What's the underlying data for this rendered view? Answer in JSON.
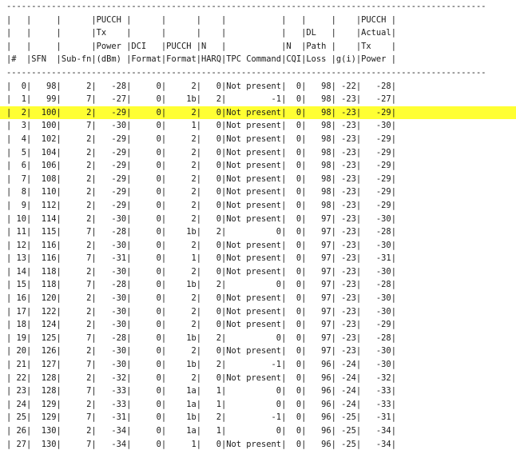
{
  "separator_top": "------------------------------------------------------------------------------------------------",
  "separator_mid": "------------------------------------------------------------------------------------------------",
  "header_lines": [
    "|   |     |      |PUCCH |      |      |    |           |   |     |    |PUCCH |",
    "|   |     |      |Tx    |      |      |    |           |   |DL   |    |Actual|",
    "|   |     |      |Power |DCI   |PUCCH |N   |           |N  |Path |    |Tx    |",
    "|#  |SFN  |Sub-fn|(dBm) |Format|Format|HARQ|TPC Command|CQI|Loss |g(i)|Power |"
  ],
  "columns": [
    "#",
    "SFN",
    "Sub-fn",
    "PUCCH Tx Power (dBm)",
    "DCI Format",
    "PUCCH Format",
    "N HARQ",
    "TPC Command",
    "N CQI",
    "DL Path Loss",
    "g(i)",
    "PUCCH Actual Tx Power"
  ],
  "highlight_color": "#ffff33",
  "highlighted_row_index": 2,
  "rows": [
    {
      "n": "0",
      "sfn": "98",
      "subfn": "2",
      "txpow": "-28",
      "dci": "0",
      "pucch": "2",
      "harq": "0",
      "tpc": "Not present",
      "cqi": "0",
      "pl": "98",
      "g": "-22",
      "actual": "-28"
    },
    {
      "n": "1",
      "sfn": "99",
      "subfn": "7",
      "txpow": "-27",
      "dci": "0",
      "pucch": "1b",
      "harq": "2",
      "tpc": "-1",
      "cqi": "0",
      "pl": "98",
      "g": "-23",
      "actual": "-27"
    },
    {
      "n": "2",
      "sfn": "100",
      "subfn": "2",
      "txpow": "-29",
      "dci": "0",
      "pucch": "2",
      "harq": "0",
      "tpc": "Not present",
      "cqi": "0",
      "pl": "98",
      "g": "-23",
      "actual": "-29"
    },
    {
      "n": "3",
      "sfn": "100",
      "subfn": "7",
      "txpow": "-30",
      "dci": "0",
      "pucch": "1",
      "harq": "0",
      "tpc": "Not present",
      "cqi": "0",
      "pl": "98",
      "g": "-23",
      "actual": "-30"
    },
    {
      "n": "4",
      "sfn": "102",
      "subfn": "2",
      "txpow": "-29",
      "dci": "0",
      "pucch": "2",
      "harq": "0",
      "tpc": "Not present",
      "cqi": "0",
      "pl": "98",
      "g": "-23",
      "actual": "-29"
    },
    {
      "n": "5",
      "sfn": "104",
      "subfn": "2",
      "txpow": "-29",
      "dci": "0",
      "pucch": "2",
      "harq": "0",
      "tpc": "Not present",
      "cqi": "0",
      "pl": "98",
      "g": "-23",
      "actual": "-29"
    },
    {
      "n": "6",
      "sfn": "106",
      "subfn": "2",
      "txpow": "-29",
      "dci": "0",
      "pucch": "2",
      "harq": "0",
      "tpc": "Not present",
      "cqi": "0",
      "pl": "98",
      "g": "-23",
      "actual": "-29"
    },
    {
      "n": "7",
      "sfn": "108",
      "subfn": "2",
      "txpow": "-29",
      "dci": "0",
      "pucch": "2",
      "harq": "0",
      "tpc": "Not present",
      "cqi": "0",
      "pl": "98",
      "g": "-23",
      "actual": "-29"
    },
    {
      "n": "8",
      "sfn": "110",
      "subfn": "2",
      "txpow": "-29",
      "dci": "0",
      "pucch": "2",
      "harq": "0",
      "tpc": "Not present",
      "cqi": "0",
      "pl": "98",
      "g": "-23",
      "actual": "-29"
    },
    {
      "n": "9",
      "sfn": "112",
      "subfn": "2",
      "txpow": "-29",
      "dci": "0",
      "pucch": "2",
      "harq": "0",
      "tpc": "Not present",
      "cqi": "0",
      "pl": "98",
      "g": "-23",
      "actual": "-29"
    },
    {
      "n": "10",
      "sfn": "114",
      "subfn": "2",
      "txpow": "-30",
      "dci": "0",
      "pucch": "2",
      "harq": "0",
      "tpc": "Not present",
      "cqi": "0",
      "pl": "97",
      "g": "-23",
      "actual": "-30"
    },
    {
      "n": "11",
      "sfn": "115",
      "subfn": "7",
      "txpow": "-28",
      "dci": "0",
      "pucch": "1b",
      "harq": "2",
      "tpc": "0",
      "cqi": "0",
      "pl": "97",
      "g": "-23",
      "actual": "-28"
    },
    {
      "n": "12",
      "sfn": "116",
      "subfn": "2",
      "txpow": "-30",
      "dci": "0",
      "pucch": "2",
      "harq": "0",
      "tpc": "Not present",
      "cqi": "0",
      "pl": "97",
      "g": "-23",
      "actual": "-30"
    },
    {
      "n": "13",
      "sfn": "116",
      "subfn": "7",
      "txpow": "-31",
      "dci": "0",
      "pucch": "1",
      "harq": "0",
      "tpc": "Not present",
      "cqi": "0",
      "pl": "97",
      "g": "-23",
      "actual": "-31"
    },
    {
      "n": "14",
      "sfn": "118",
      "subfn": "2",
      "txpow": "-30",
      "dci": "0",
      "pucch": "2",
      "harq": "0",
      "tpc": "Not present",
      "cqi": "0",
      "pl": "97",
      "g": "-23",
      "actual": "-30"
    },
    {
      "n": "15",
      "sfn": "118",
      "subfn": "7",
      "txpow": "-28",
      "dci": "0",
      "pucch": "1b",
      "harq": "2",
      "tpc": "0",
      "cqi": "0",
      "pl": "97",
      "g": "-23",
      "actual": "-28"
    },
    {
      "n": "16",
      "sfn": "120",
      "subfn": "2",
      "txpow": "-30",
      "dci": "0",
      "pucch": "2",
      "harq": "0",
      "tpc": "Not present",
      "cqi": "0",
      "pl": "97",
      "g": "-23",
      "actual": "-30"
    },
    {
      "n": "17",
      "sfn": "122",
      "subfn": "2",
      "txpow": "-30",
      "dci": "0",
      "pucch": "2",
      "harq": "0",
      "tpc": "Not present",
      "cqi": "0",
      "pl": "97",
      "g": "-23",
      "actual": "-30"
    },
    {
      "n": "18",
      "sfn": "124",
      "subfn": "2",
      "txpow": "-30",
      "dci": "0",
      "pucch": "2",
      "harq": "0",
      "tpc": "Not present",
      "cqi": "0",
      "pl": "97",
      "g": "-23",
      "actual": "-29"
    },
    {
      "n": "19",
      "sfn": "125",
      "subfn": "7",
      "txpow": "-28",
      "dci": "0",
      "pucch": "1b",
      "harq": "2",
      "tpc": "0",
      "cqi": "0",
      "pl": "97",
      "g": "-23",
      "actual": "-28"
    },
    {
      "n": "20",
      "sfn": "126",
      "subfn": "2",
      "txpow": "-30",
      "dci": "0",
      "pucch": "2",
      "harq": "0",
      "tpc": "Not present",
      "cqi": "0",
      "pl": "97",
      "g": "-23",
      "actual": "-30"
    },
    {
      "n": "21",
      "sfn": "127",
      "subfn": "7",
      "txpow": "-30",
      "dci": "0",
      "pucch": "1b",
      "harq": "2",
      "tpc": "-1",
      "cqi": "0",
      "pl": "96",
      "g": "-24",
      "actual": "-30"
    },
    {
      "n": "22",
      "sfn": "128",
      "subfn": "2",
      "txpow": "-32",
      "dci": "0",
      "pucch": "2",
      "harq": "0",
      "tpc": "Not present",
      "cqi": "0",
      "pl": "96",
      "g": "-24",
      "actual": "-32"
    },
    {
      "n": "23",
      "sfn": "128",
      "subfn": "7",
      "txpow": "-33",
      "dci": "0",
      "pucch": "1a",
      "harq": "1",
      "tpc": "0",
      "cqi": "0",
      "pl": "96",
      "g": "-24",
      "actual": "-33"
    },
    {
      "n": "24",
      "sfn": "129",
      "subfn": "2",
      "txpow": "-33",
      "dci": "0",
      "pucch": "1a",
      "harq": "1",
      "tpc": "0",
      "cqi": "0",
      "pl": "96",
      "g": "-24",
      "actual": "-33"
    },
    {
      "n": "25",
      "sfn": "129",
      "subfn": "7",
      "txpow": "-31",
      "dci": "0",
      "pucch": "1b",
      "harq": "2",
      "tpc": "-1",
      "cqi": "0",
      "pl": "96",
      "g": "-25",
      "actual": "-31"
    },
    {
      "n": "26",
      "sfn": "130",
      "subfn": "2",
      "txpow": "-34",
      "dci": "0",
      "pucch": "1a",
      "harq": "1",
      "tpc": "0",
      "cqi": "0",
      "pl": "96",
      "g": "-25",
      "actual": "-34"
    },
    {
      "n": "27",
      "sfn": "130",
      "subfn": "7",
      "txpow": "-34",
      "dci": "0",
      "pucch": "1",
      "harq": "0",
      "tpc": "Not present",
      "cqi": "0",
      "pl": "96",
      "g": "-25",
      "actual": "-34"
    }
  ]
}
